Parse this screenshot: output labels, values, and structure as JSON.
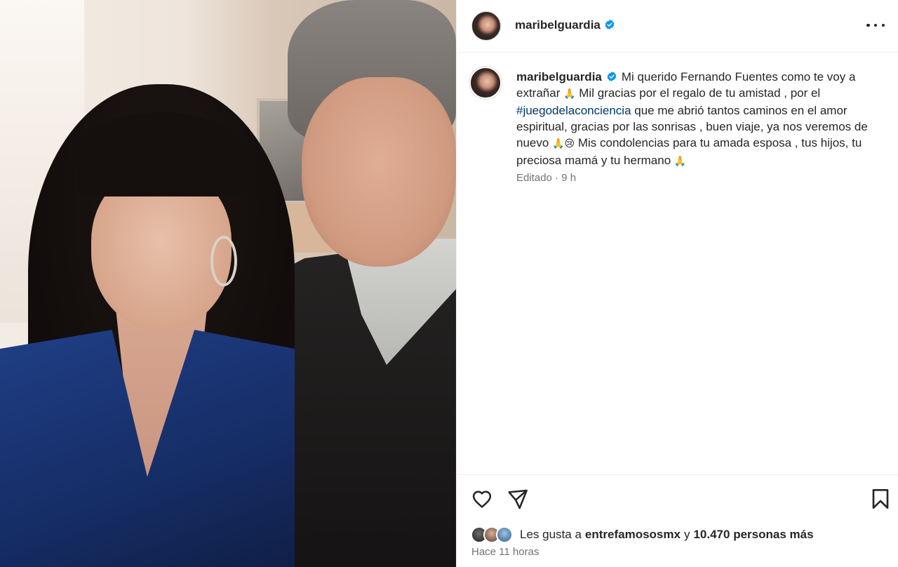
{
  "post": {
    "username": "maribelguardia",
    "verified": true,
    "caption_parts": {
      "p1": "Mi querido Fernando Fuentes como te voy a extrañar",
      "p2": " Mil gracias por el regalo de tu amistad , por el ",
      "hashtag": "#juegodelaconciencia",
      "p3": " que me abrió tantos caminos en el amor espiritual, gracias por las sonrisas , buen viaje, ya nos veremos de nuevo",
      "p4": " Mis condolencias para tu amada esposa , tus hijos, tu preciosa mamá y tu hermano"
    },
    "emoji": {
      "pray": "🙏",
      "sad": "😢"
    },
    "caption_meta": "Editado · 9 h"
  },
  "likes": {
    "prefix": "Les gusta a",
    "first_liker": "entrefamososmx",
    "conjunction": "y",
    "others": "10.470 personas más"
  },
  "timestamp": "Hace 11 horas",
  "icons": {
    "more": "more-options-icon",
    "like": "heart-icon",
    "share": "paper-plane-icon",
    "save": "bookmark-icon",
    "verified": "verified-badge-icon"
  },
  "colors": {
    "verified_blue": "#0095f6",
    "hashtag": "#00376b",
    "secondary_text": "#737373"
  }
}
